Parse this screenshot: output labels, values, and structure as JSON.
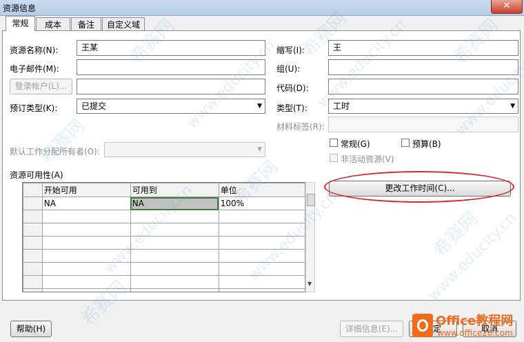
{
  "window": {
    "title": "资源信息",
    "close_glyph": "✕"
  },
  "tabs": [
    {
      "label": "常规",
      "active": true
    },
    {
      "label": "成本",
      "active": false
    },
    {
      "label": "备注",
      "active": false
    },
    {
      "label": "自定义域",
      "active": false
    }
  ],
  "form": {
    "resource_name_label": "资源名称(N):",
    "resource_name_value": "王某",
    "email_label": "电子邮件(M):",
    "email_value": "",
    "login_account_button": "登录帐户(L)...",
    "login_account_value": "",
    "booking_type_label": "预订类型(K):",
    "booking_type_value": "已提交",
    "default_owner_label": "默认工作分配所有者(O):",
    "default_owner_value": "",
    "initials_label": "缩写(I):",
    "initials_value": "王",
    "group_label": "组(U):",
    "group_value": "",
    "code_label": "代码(D):",
    "code_value": "",
    "type_label": "类型(T):",
    "type_value": "工时",
    "material_label": "材料标签(R):",
    "material_value": "",
    "generic_checkbox": "常规(G)",
    "budget_checkbox": "预算(B)",
    "inactive_checkbox": "非活动资源(V)",
    "generic_checked": false,
    "budget_checked": false,
    "inactive_checked": false
  },
  "availability": {
    "label": "资源可用性(A)",
    "columns": [
      "开始可用",
      "可用到",
      "单位"
    ],
    "rows": [
      [
        "NA",
        "NA",
        "100%"
      ]
    ]
  },
  "buttons": {
    "change_working_time": "更改工作时间(C)...",
    "help": "帮助(H)",
    "details": "详细信息(E)...",
    "ok_partial": "定",
    "cancel_partial": "取消"
  },
  "watermark": {
    "site_text": "www.educity.cn",
    "brand_text": "希赛网",
    "logo_title": "Office教程网",
    "logo_url": "www.office26.com"
  },
  "colors": {
    "accent_red": "#e0232a",
    "selected_cell_border": "#3d7d3d",
    "logo_orange": "#f26b1d"
  }
}
